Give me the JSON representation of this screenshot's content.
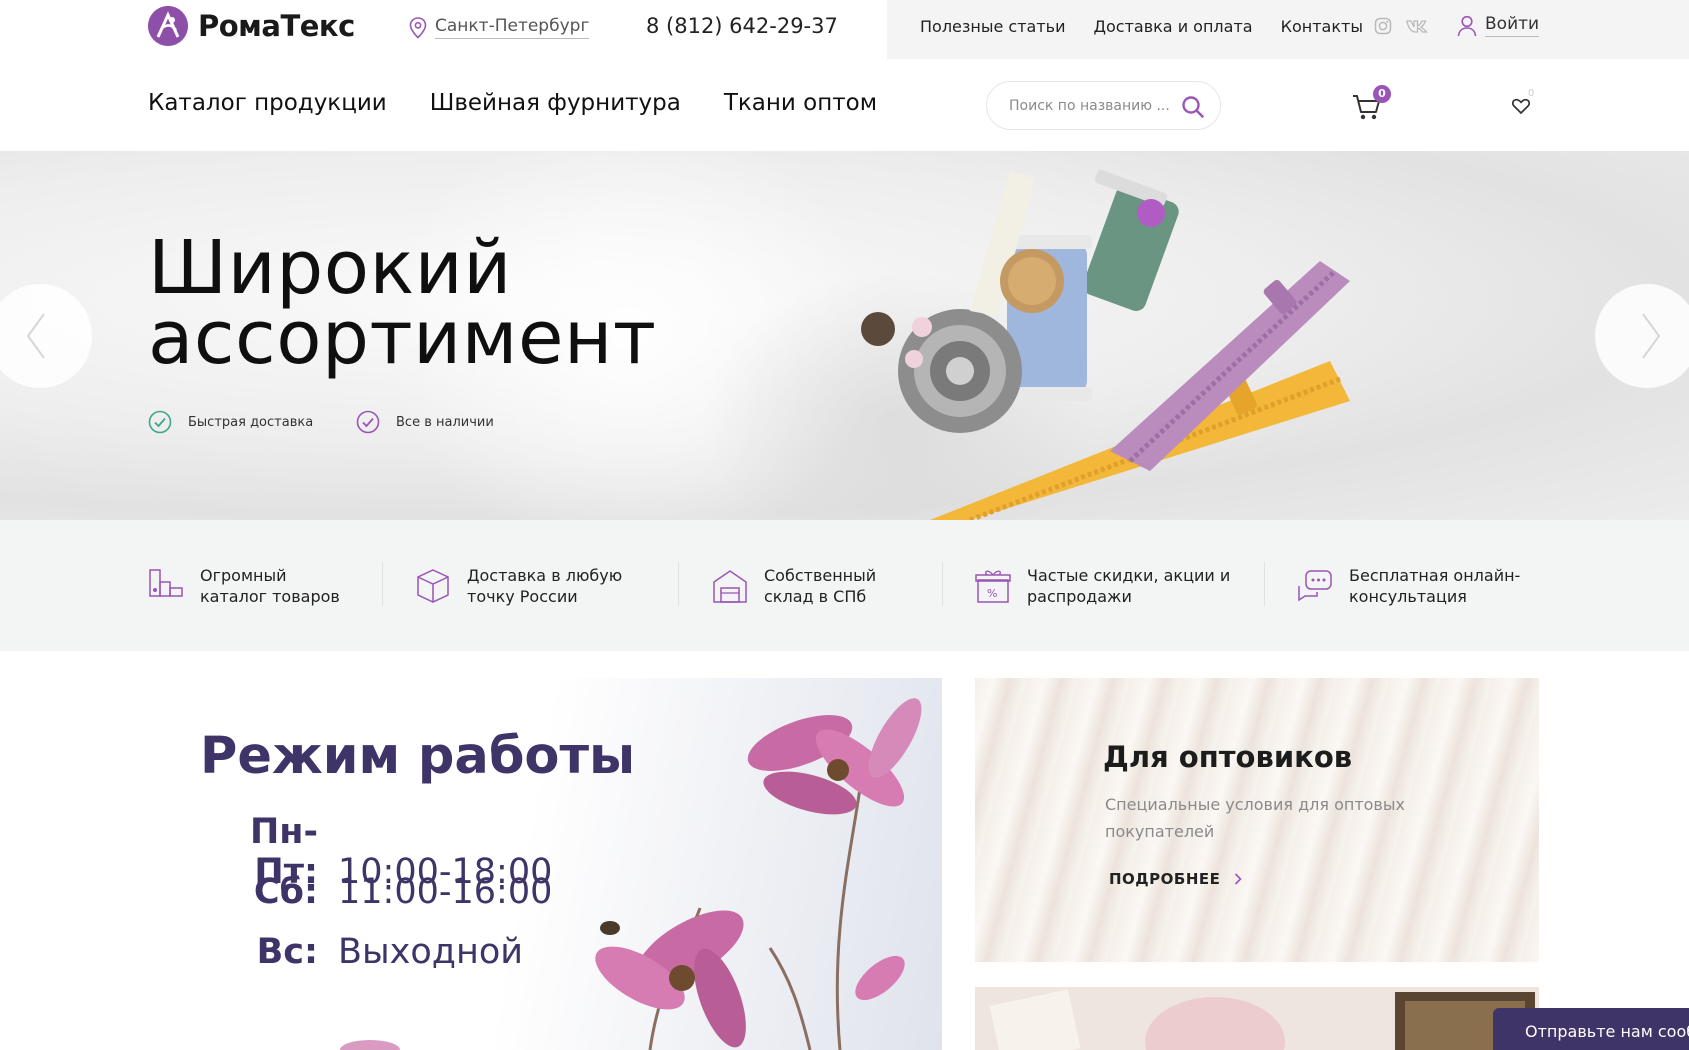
{
  "header": {
    "logo_text": "РомаТекс",
    "city": "Санкт-Петербург",
    "phone": "8 (812) 642-29-37",
    "links": [
      "Полезные статьи",
      "Доставка и оплата",
      "Контакты"
    ],
    "social_icons": [
      "instagram-icon",
      "vk-icon"
    ],
    "login_label": "Войти"
  },
  "nav": {
    "items": [
      "Каталог продукции",
      "Швейная фурнитура",
      "Ткани оптом"
    ],
    "search_placeholder": "Поиск по названию ...",
    "cart_count": "0",
    "favorites_count": "0"
  },
  "hero": {
    "title_line1": "Широкий",
    "title_line2": "ассортимент",
    "features": [
      "Быстрая доставка",
      "Все в наличии"
    ]
  },
  "benefits": [
    {
      "icon": "catalog-icon",
      "text": "Огромный\nкаталог товаров"
    },
    {
      "icon": "delivery-box-icon",
      "text": "Доставка в любую\nточку России"
    },
    {
      "icon": "warehouse-icon",
      "text": "Собственный\nсклад в СПб"
    },
    {
      "icon": "gift-discount-icon",
      "text": "Частые скидки, акции и\nраспродажи"
    },
    {
      "icon": "chat-consult-icon",
      "text": "Бесплатная онлайн-\nконсультация"
    }
  ],
  "schedule": {
    "title": "Режим работы",
    "rows": [
      {
        "label": "Пн-Пт:",
        "value": "10:00-18:00"
      },
      {
        "label": "Сб:",
        "value": "11:00-16:00"
      },
      {
        "label": "Вс:",
        "value": "Выходной"
      }
    ]
  },
  "wholesale": {
    "title": "Для оптовиков",
    "subtitle": "Специальные условия для оптовых покупателей",
    "more_label": "ПОДРОБНЕЕ"
  },
  "feedback": {
    "label": "Отправьте нам сообщение"
  },
  "colors": {
    "brand_purple": "#9a55b7",
    "dark_purple": "#3f3468",
    "check_green": "#3aa889"
  }
}
